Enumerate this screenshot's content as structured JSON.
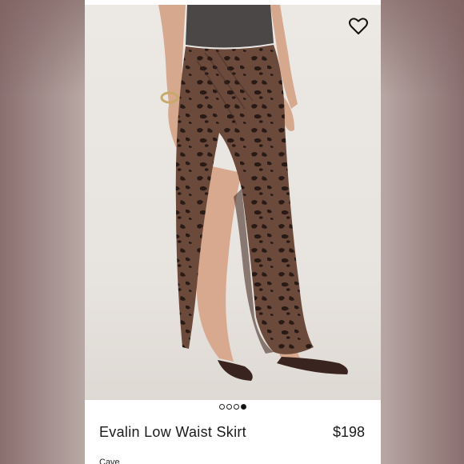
{
  "product": {
    "name": "Evalin Low Waist Skirt",
    "price": "$198",
    "color": "Cave",
    "image_count": 4,
    "active_image": 4
  },
  "icons": {
    "favorite": "heart-outline-icon"
  },
  "colors": {
    "skirt": "#6b4a3c",
    "spots": "#2a1a15",
    "top": "#4a4746",
    "skin": "#d8a98e"
  }
}
